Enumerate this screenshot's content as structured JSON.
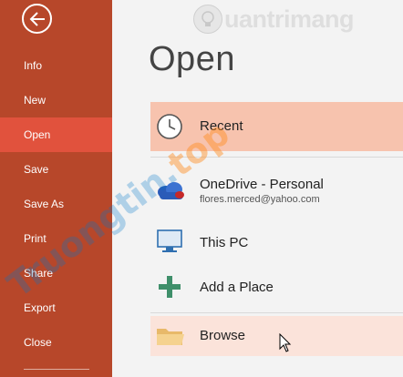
{
  "sidebar": {
    "back_icon": "back-arrow-icon",
    "items": [
      {
        "label": "Info",
        "active": false
      },
      {
        "label": "New",
        "active": false
      },
      {
        "label": "Open",
        "active": true
      },
      {
        "label": "Save",
        "active": false
      },
      {
        "label": "Save As",
        "active": false
      },
      {
        "label": "Print",
        "active": false
      },
      {
        "label": "Share",
        "active": false
      },
      {
        "label": "Export",
        "active": false
      },
      {
        "label": "Close",
        "active": false
      }
    ],
    "colors": {
      "background": "#b7472a",
      "active": "#e1523d"
    }
  },
  "main": {
    "title": "Open",
    "locations": [
      {
        "label": "Recent",
        "icon": "clock-icon",
        "state": "selected"
      },
      {
        "label": "OneDrive - Personal",
        "sublabel": "flores.merced@yahoo.com",
        "icon": "onedrive-cloud-icon"
      },
      {
        "label": "This PC",
        "icon": "computer-icon"
      },
      {
        "label": "Add a Place",
        "icon": "plus-icon"
      },
      {
        "label": "Browse",
        "icon": "folder-icon",
        "state": "hover"
      }
    ],
    "colors": {
      "selected": "#f7c3ae",
      "hover": "#fbe3da"
    }
  },
  "watermark": {
    "logo_text": "uantrimang",
    "diagonal_a": "Truong",
    "diagonal_b": "tin.",
    "diagonal_c": "top"
  }
}
